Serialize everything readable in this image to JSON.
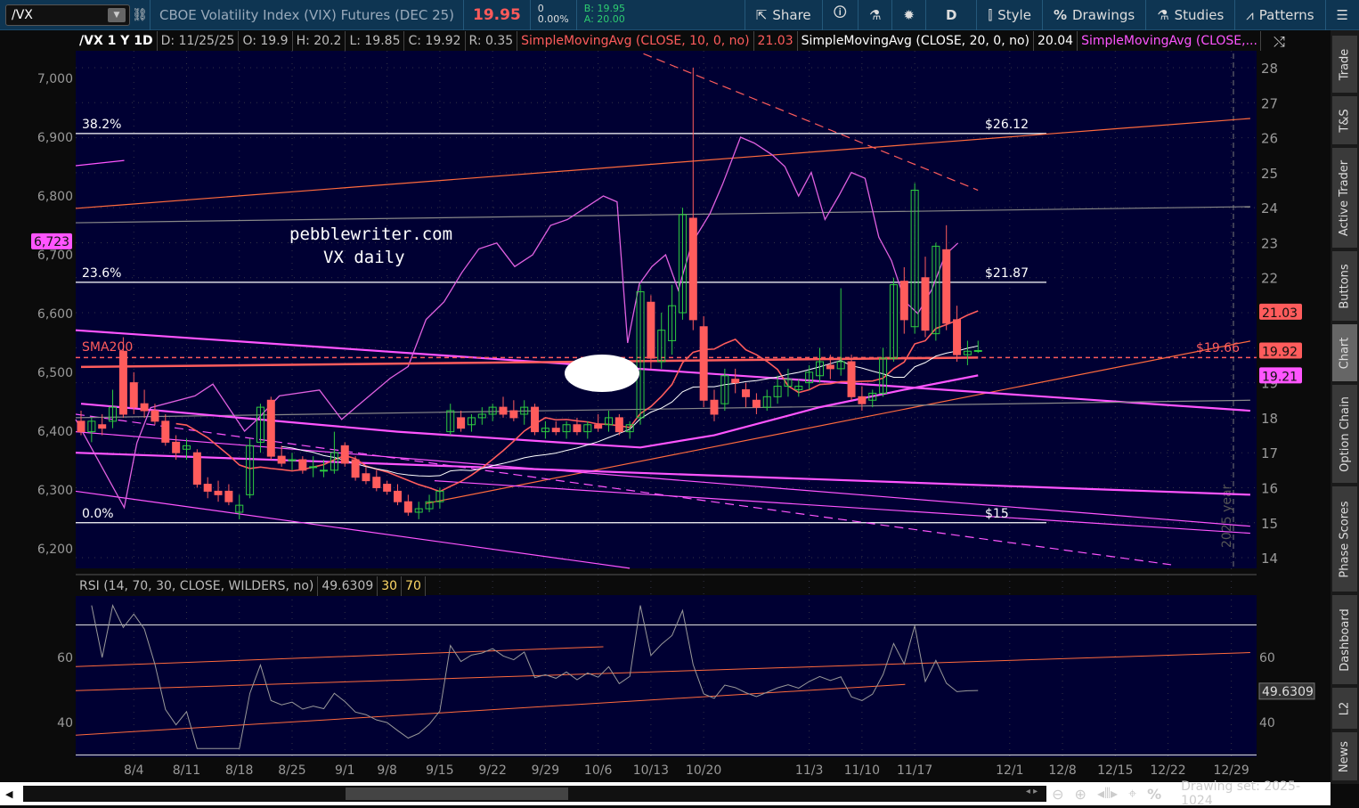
{
  "toolbar": {
    "symbol": "/VX",
    "description": "CBOE Volatility Index (VIX) Futures (DEC 25)",
    "last": "19.95",
    "net_change": "0",
    "pct_change": "0.00%",
    "bid": "B: 19.95",
    "ask": "A: 20.00",
    "share": "Share",
    "period": "D",
    "style": "Style",
    "drawings": "Drawings",
    "studies": "Studies",
    "patterns": "Patterns"
  },
  "legend": {
    "title": "/VX 1 Y 1D",
    "date": "D: 11/25/25",
    "open": "O: 19.9",
    "high": "H: 20.2",
    "low": "L: 19.85",
    "close": "C: 19.92",
    "range": "R: 0.35",
    "sma10": "SimpleMovingAvg (CLOSE, 10, 0, no)",
    "sma10_val": "21.03",
    "sma20": "SimpleMovingAvg (CLOSE, 20, 0, no)",
    "sma20_val": "20.04",
    "sma3": "SimpleMovingAvg (CLOSE,..."
  },
  "rsi_legend": {
    "label": "RSI (14, 70, 30, CLOSE, WILDERS, no)",
    "value": "49.6309",
    "os": "30",
    "ob": "70"
  },
  "sidebar": [
    "Trade",
    "T&S",
    "Active Trader",
    "Buttons",
    "Chart",
    "Option Chain",
    "Phase Scores",
    "Dashboard",
    "L2",
    "News"
  ],
  "bottom": {
    "drawing_set": "Drawing set: 2025-1024"
  },
  "colors": {
    "up": "#2ecc40",
    "down": "#ff5c5c",
    "sma10": "#ff5c5c",
    "sma20": "#ffffff",
    "magenta": "#ff55ff",
    "bg": "#000033"
  },
  "chart_data": {
    "type": "candlestick",
    "watermark": [
      "pebblewriter.com",
      "VX daily"
    ],
    "right_axis_ticks": [
      28,
      27,
      26,
      25,
      24,
      23,
      22,
      21,
      20,
      19,
      18,
      17,
      16,
      15,
      14
    ],
    "left_axis_ticks": [
      "7,000",
      "6,900",
      "6,800",
      "6,700",
      "6,600",
      "6,500",
      "6,400",
      "6,300",
      "6,200"
    ],
    "left_axis_values": [
      7000,
      6900,
      6800,
      6700,
      6600,
      6500,
      6400,
      6300,
      6200
    ],
    "left_marker": "6,723",
    "left_marker_value": 6723,
    "price_markers": [
      {
        "label": "21.03",
        "value": 21.03,
        "color": "#ff5c5c"
      },
      {
        "label": "19.92",
        "value": 19.92,
        "color": "#ff5c5c"
      },
      {
        "label": "19.21",
        "value": 19.21,
        "color": "#ff55ff"
      }
    ],
    "x_ticks": [
      {
        "label": "8/4",
        "i": 5
      },
      {
        "label": "8/11",
        "i": 10
      },
      {
        "label": "8/18",
        "i": 15
      },
      {
        "label": "8/25",
        "i": 20
      },
      {
        "label": "9/1",
        "i": 25
      },
      {
        "label": "9/8",
        "i": 29
      },
      {
        "label": "9/15",
        "i": 34
      },
      {
        "label": "9/22",
        "i": 39
      },
      {
        "label": "9/29",
        "i": 44
      },
      {
        "label": "10/6",
        "i": 49
      },
      {
        "label": "10/13",
        "i": 54
      },
      {
        "label": "10/20",
        "i": 59
      },
      {
        "label": "11/3",
        "i": 69
      },
      {
        "label": "11/10",
        "i": 74
      },
      {
        "label": "11/17",
        "i": 79
      },
      {
        "label": "12/1",
        "i": 88
      },
      {
        "label": "12/8",
        "i": 93
      },
      {
        "label": "12/15",
        "i": 98
      },
      {
        "label": "12/22",
        "i": 103
      },
      {
        "label": "12/29",
        "i": 109
      }
    ],
    "fib": [
      {
        "pct": "38.2%",
        "price": "$26.12",
        "value": 26.12
      },
      {
        "pct": "23.6%",
        "price": "$21.87",
        "value": 21.87
      },
      {
        "pct": "0.0%",
        "price": "$15",
        "value": 15.0
      }
    ],
    "sma200_label": "SMA200",
    "sma200_price": "$19.66",
    "year_label": "2025 year",
    "ohlc": [
      [
        17.9,
        18.2,
        17.5,
        17.6
      ],
      [
        17.6,
        18.0,
        17.3,
        17.9
      ],
      [
        17.8,
        18.1,
        17.5,
        17.7
      ],
      [
        17.9,
        18.8,
        17.7,
        18.3
      ],
      [
        19.9,
        20.3,
        18.0,
        18.1
      ],
      [
        19.0,
        19.3,
        18.1,
        18.3
      ],
      [
        18.4,
        18.8,
        18.0,
        18.2
      ],
      [
        18.2,
        18.4,
        17.8,
        17.9
      ],
      [
        17.9,
        18.1,
        17.2,
        17.3
      ],
      [
        17.3,
        17.5,
        16.8,
        17.0
      ],
      [
        17.1,
        17.4,
        16.8,
        17.2
      ],
      [
        17.0,
        17.1,
        16.0,
        16.1
      ],
      [
        16.1,
        16.3,
        15.7,
        15.9
      ],
      [
        15.9,
        16.2,
        15.6,
        15.8
      ],
      [
        15.9,
        16.1,
        15.5,
        15.6
      ],
      [
        15.3,
        15.8,
        15.1,
        15.5
      ],
      [
        15.8,
        17.4,
        15.7,
        17.2
      ],
      [
        17.3,
        18.4,
        17.0,
        18.3
      ],
      [
        18.5,
        18.6,
        16.8,
        16.9
      ],
      [
        16.9,
        17.2,
        16.6,
        16.7
      ],
      [
        16.8,
        17.0,
        16.5,
        16.8
      ],
      [
        16.8,
        16.9,
        16.4,
        16.5
      ],
      [
        16.6,
        16.9,
        16.3,
        16.6
      ],
      [
        16.5,
        16.8,
        16.3,
        16.5
      ],
      [
        16.5,
        17.6,
        16.4,
        17.0
      ],
      [
        17.2,
        17.3,
        16.6,
        16.7
      ],
      [
        16.8,
        16.9,
        16.2,
        16.3
      ],
      [
        16.4,
        16.6,
        16.1,
        16.2
      ],
      [
        16.3,
        16.5,
        15.9,
        16.0
      ],
      [
        16.1,
        16.2,
        15.8,
        15.9
      ],
      [
        15.9,
        16.1,
        15.5,
        15.6
      ],
      [
        15.6,
        15.8,
        15.2,
        15.3
      ],
      [
        15.3,
        15.6,
        15.1,
        15.4
      ],
      [
        15.4,
        15.8,
        15.3,
        15.6
      ],
      [
        15.6,
        16.0,
        15.4,
        15.9
      ],
      [
        17.6,
        18.4,
        17.5,
        18.2
      ],
      [
        18.0,
        18.2,
        17.6,
        17.7
      ],
      [
        17.8,
        18.1,
        17.6,
        18.0
      ],
      [
        18.0,
        18.3,
        17.8,
        18.1
      ],
      [
        18.1,
        18.4,
        17.9,
        18.3
      ],
      [
        18.3,
        18.6,
        18.0,
        18.1
      ],
      [
        18.2,
        18.5,
        17.9,
        18.0
      ],
      [
        18.1,
        18.5,
        17.8,
        18.3
      ],
      [
        18.3,
        18.4,
        17.5,
        17.6
      ],
      [
        17.6,
        17.9,
        17.4,
        17.7
      ],
      [
        17.7,
        17.9,
        17.5,
        17.6
      ],
      [
        17.6,
        17.9,
        17.4,
        17.8
      ],
      [
        17.8,
        18.0,
        17.5,
        17.6
      ],
      [
        17.6,
        17.9,
        17.4,
        17.8
      ],
      [
        17.8,
        18.1,
        17.6,
        17.7
      ],
      [
        17.8,
        18.2,
        17.6,
        18.0
      ],
      [
        18.0,
        18.1,
        17.5,
        17.6
      ],
      [
        17.6,
        17.9,
        17.4,
        17.8
      ],
      [
        18.0,
        21.8,
        17.8,
        21.6
      ],
      [
        21.3,
        21.5,
        19.4,
        19.7
      ],
      [
        19.6,
        21.0,
        19.4,
        20.5
      ],
      [
        20.2,
        21.8,
        19.8,
        21.2
      ],
      [
        21.0,
        24.0,
        20.8,
        23.8
      ],
      [
        23.7,
        28.0,
        20.5,
        20.8
      ],
      [
        20.6,
        20.9,
        18.3,
        18.5
      ],
      [
        18.5,
        18.8,
        17.9,
        18.1
      ],
      [
        18.4,
        19.4,
        18.2,
        19.2
      ],
      [
        19.1,
        19.4,
        18.7,
        19.0
      ],
      [
        18.8,
        19.0,
        18.3,
        18.6
      ],
      [
        18.5,
        18.7,
        18.1,
        18.3
      ],
      [
        18.3,
        18.8,
        18.2,
        18.6
      ],
      [
        18.6,
        19.2,
        18.4,
        18.9
      ],
      [
        18.9,
        19.4,
        18.6,
        19.1
      ],
      [
        18.8,
        19.1,
        18.6,
        18.9
      ],
      [
        19.0,
        19.5,
        18.8,
        19.3
      ],
      [
        19.2,
        20.0,
        19.0,
        19.6
      ],
      [
        19.5,
        19.8,
        19.1,
        19.4
      ],
      [
        19.4,
        21.7,
        19.2,
        19.6
      ],
      [
        19.6,
        19.8,
        18.5,
        18.6
      ],
      [
        18.6,
        18.9,
        18.2,
        18.4
      ],
      [
        18.5,
        18.8,
        18.3,
        18.7
      ],
      [
        18.7,
        20.0,
        18.6,
        19.7
      ],
      [
        19.7,
        22.0,
        19.6,
        21.8
      ],
      [
        21.9,
        22.3,
        20.4,
        20.8
      ],
      [
        20.6,
        24.7,
        20.4,
        24.5
      ],
      [
        22.0,
        22.6,
        20.3,
        20.5
      ],
      [
        20.4,
        23.0,
        20.2,
        22.9
      ],
      [
        22.8,
        23.5,
        20.5,
        20.7
      ],
      [
        20.8,
        21.2,
        19.6,
        19.8
      ],
      [
        19.8,
        20.2,
        19.5,
        19.9
      ],
      [
        19.9,
        20.2,
        19.85,
        19.92
      ]
    ],
    "es_overlay": [
      [
        0,
        6420
      ],
      [
        4.6,
        6270
      ],
      [
        5.8,
        6380
      ],
      [
        7.1,
        6440
      ],
      [
        11.3,
        6460
      ],
      [
        13,
        6480
      ],
      [
        16,
        6400
      ],
      [
        17.2,
        6420
      ],
      [
        19.3,
        6460
      ],
      [
        23.1,
        6470
      ],
      [
        25.2,
        6420
      ],
      [
        26.5,
        6440
      ],
      [
        29.8,
        6490
      ],
      [
        31.5,
        6510
      ],
      [
        33.2,
        6590
      ],
      [
        34.9,
        6620
      ],
      [
        36.6,
        6670
      ],
      [
        38.2,
        6710
      ],
      [
        39.9,
        6720
      ],
      [
        41.6,
        6680
      ],
      [
        43.3,
        6700
      ],
      [
        45,
        6750
      ],
      [
        46.6,
        6760
      ],
      [
        48.3,
        6780
      ],
      [
        50,
        6800
      ],
      [
        51.3,
        6790
      ],
      [
        52.3,
        6550
      ],
      [
        53.4,
        6650
      ],
      [
        54.6,
        6680
      ],
      [
        55.9,
        6700
      ],
      [
        57.1,
        6640
      ],
      [
        58.4,
        6720
      ],
      [
        60.1,
        6770
      ],
      [
        61.3,
        6820
      ],
      [
        63,
        6900
      ],
      [
        64.3,
        6890
      ],
      [
        66,
        6870
      ],
      [
        67.2,
        6850
      ],
      [
        68.5,
        6800
      ],
      [
        69.7,
        6840
      ],
      [
        71,
        6760
      ],
      [
        72.3,
        6800
      ],
      [
        73.5,
        6840
      ],
      [
        74.8,
        6830
      ],
      [
        76.1,
        6730
      ],
      [
        77.3,
        6690
      ],
      [
        78.6,
        6620
      ],
      [
        79.8,
        6600
      ],
      [
        81.1,
        6640
      ],
      [
        82.4,
        6700
      ],
      [
        83.6,
        6720
      ]
    ],
    "sma200": [
      [
        0,
        19.45
      ],
      [
        85,
        19.72
      ]
    ],
    "sma50": [
      [
        0,
        18.4
      ],
      [
        15,
        18.0
      ],
      [
        30,
        17.6
      ],
      [
        45,
        17.3
      ],
      [
        53,
        17.15
      ],
      [
        60,
        17.5
      ],
      [
        70,
        18.3
      ],
      [
        78,
        18.8
      ],
      [
        85,
        19.21
      ]
    ],
    "drawings": [
      {
        "type": "trend",
        "color": "#ff6a3d",
        "points": [
          [
            0,
            23.98
          ],
          [
            111.3,
            26.55
          ]
        ]
      },
      {
        "type": "trend",
        "color": "#888888",
        "points": [
          [
            0,
            23.57
          ],
          [
            111.3,
            24.03
          ]
        ]
      },
      {
        "type": "dashed",
        "color": "#ff5c5c",
        "points": [
          [
            53.8,
            28.4
          ],
          [
            85.5,
            24.5
          ]
        ]
      },
      {
        "type": "trend",
        "color": "#ff6a3d",
        "points": [
          [
            33.2,
            15.55
          ],
          [
            111.3,
            20.19
          ]
        ]
      },
      {
        "type": "thick",
        "color": "#ff55ff",
        "points": [
          [
            0,
            20.5
          ],
          [
            111.3,
            18.2
          ]
        ]
      },
      {
        "type": "thick",
        "color": "#ff55ff",
        "points": [
          [
            0,
            17.0
          ],
          [
            111.3,
            15.8
          ]
        ]
      },
      {
        "type": "thin",
        "color": "#ff55ff",
        "points": [
          [
            0,
            17.6
          ],
          [
            111.3,
            14.9
          ]
        ]
      },
      {
        "type": "thin",
        "color": "#ff55ff",
        "points": [
          [
            0,
            15.9
          ],
          [
            52.5,
            13.7
          ]
        ]
      },
      {
        "type": "thin",
        "color": "#ff55ff",
        "points": [
          [
            34,
            16.2
          ],
          [
            111.3,
            14.7
          ]
        ]
      },
      {
        "type": "dashed",
        "color": "#ff55ff",
        "points": [
          [
            0,
            18.1
          ],
          [
            103.8,
            13.8
          ]
        ]
      },
      {
        "type": "trend",
        "color": "#888888",
        "points": [
          [
            0,
            18.0
          ],
          [
            111.3,
            18.5
          ]
        ]
      },
      {
        "type": "thin",
        "color": "#ff55ff",
        "points": [
          [
            0,
            25.2
          ],
          [
            4.6,
            25.35
          ]
        ]
      }
    ],
    "rsi": {
      "ylim": [
        30,
        75
      ],
      "ticks": [
        60,
        40
      ],
      "ob": 70,
      "os": 30,
      "drawings": [
        [
          [
            0,
            57.2
          ],
          [
            50,
            63.3
          ]
        ],
        [
          [
            0,
            49.8
          ],
          [
            111.3,
            61.5
          ]
        ],
        [
          [
            0,
            36.1
          ],
          [
            78.6,
            51.7
          ]
        ]
      ]
    }
  }
}
